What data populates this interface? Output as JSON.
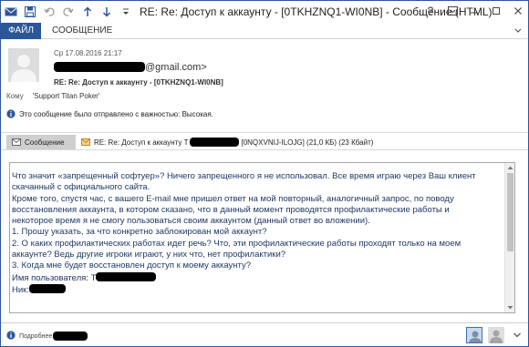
{
  "window": {
    "title": "RE: Re: Доступ к аккаунту - [0TKHZNQ1-WI0NB] - Сообщение (HTML)",
    "help_label": "?"
  },
  "ribbon": {
    "tabs": [
      {
        "label": "ФАЙЛ",
        "active": true
      },
      {
        "label": "СООБЩЕНИЕ",
        "active": false
      }
    ]
  },
  "header": {
    "date": "Ср 17.08.2016 21:17",
    "sender_suffix": "@gmail.com>",
    "subject": "RE: Re: Доступ к аккаунту - [0TKHZNQ1-WI0NB]",
    "to_label": "Кому",
    "to_value": "'Support Titan Poker'",
    "importance_text": "Это сообщение было отправлено с важностью: Высокая."
  },
  "attachments": {
    "message_tab": "Сообщение",
    "file_prefix": "RE: Re: Доступ к аккаунту T",
    "file_suffix": "[0NQXVNIJ-ILOJG] (21,0 КБ) (23 Кбайт)"
  },
  "body": {
    "lines": [
      "Что значит «запрещенный софтуер»? Ничего запрещенного я не использовал. Все время играю через Ваш клиент",
      "скачанный с официального сайта.",
      "Кроме того, спустя час, с вашего E-mail мне пришел ответ на мой повторный, аналогичный запрос, по поводу",
      "восстановления аккаунта, в котором сказано, что в данный момент проводятся профилактические работы и",
      "некоторое время я не смогу пользоваться своим аккаунтом (данный ответ во вложении).",
      "1. Прошу указать, за что конкретно заблокирован мой аккаунт?",
      "2. О каких профилактических работах идет речь? Что, эти профилактические работы проходят только на моем",
      "аккаунте? Ведь другие игроки играют, у них что, нет профилактики?",
      "3. Когда мне будет восстановлен доступ к моему аккаунту?"
    ],
    "username_label": "Имя пользователя: T",
    "nick_label": "Ник:"
  },
  "footer": {
    "more_label": "Подробнее"
  },
  "colors": {
    "accent": "#2b579a",
    "body_text": "#1f3864"
  }
}
